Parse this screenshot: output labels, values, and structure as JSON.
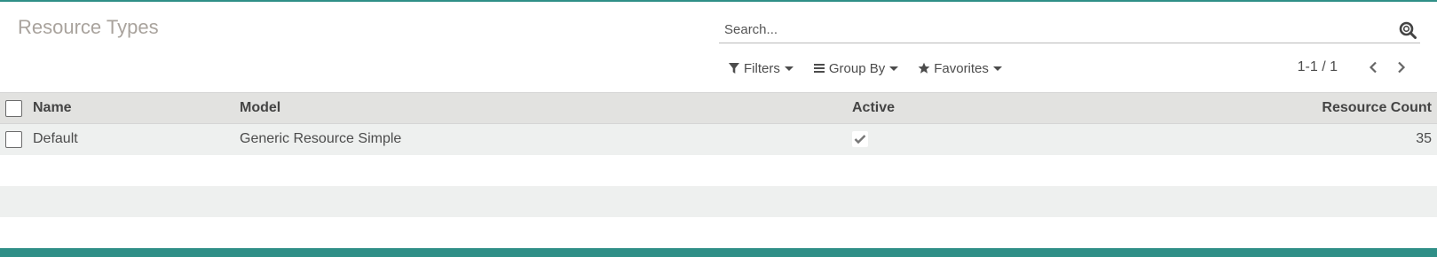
{
  "page": {
    "title": "Resource Types"
  },
  "search": {
    "placeholder": "Search..."
  },
  "filters": {
    "filters_label": "Filters",
    "group_by_label": "Group By",
    "favorites_label": "Favorites"
  },
  "pager": {
    "value": "1-1 / 1"
  },
  "table": {
    "columns": {
      "name": "Name",
      "model": "Model",
      "active": "Active",
      "count": "Resource Count"
    },
    "rows": [
      {
        "name": "Default",
        "model": "Generic Resource Simple",
        "active": true,
        "count": "35"
      }
    ]
  },
  "colors": {
    "accent": "#2f8f87",
    "header_bg": "#e2e2e0",
    "row_bg": "#eef0ef"
  }
}
